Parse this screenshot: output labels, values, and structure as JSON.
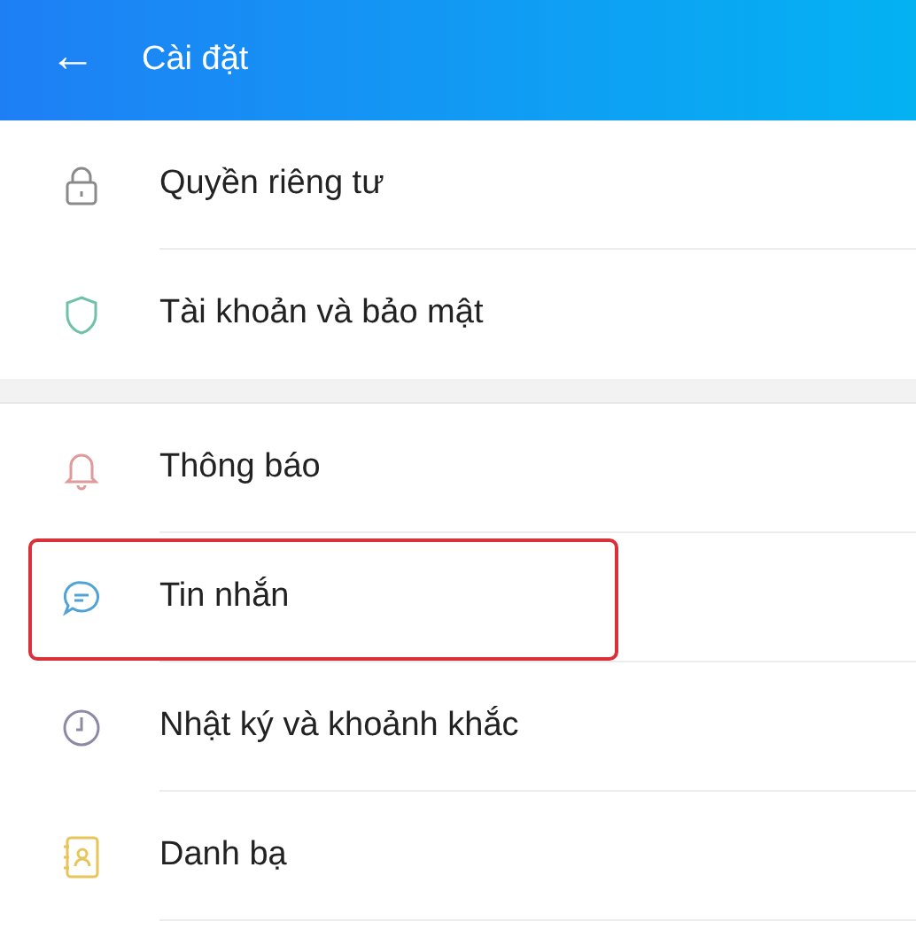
{
  "header": {
    "back": "←",
    "title": "Cài đặt"
  },
  "sections": [
    {
      "items": [
        {
          "label": "Quyền riêng tư",
          "highlighted": false
        },
        {
          "label": "Tài khoản và bảo mật",
          "highlighted": false
        }
      ]
    },
    {
      "items": [
        {
          "label": "Thông báo",
          "highlighted": false
        },
        {
          "label": "Tin nhắn",
          "highlighted": true
        },
        {
          "label": "Nhật ký và khoảnh khắc",
          "highlighted": false
        },
        {
          "label": "Danh bạ",
          "highlighted": false
        }
      ]
    }
  ]
}
